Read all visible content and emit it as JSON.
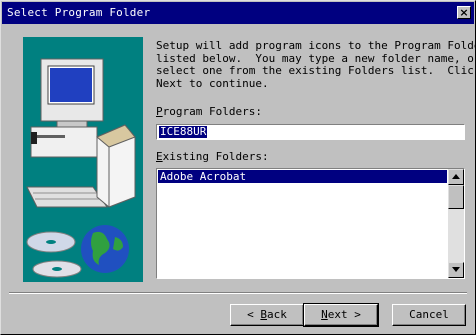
{
  "window": {
    "title": "Select Program Folder",
    "close_label": "×"
  },
  "intro_text": "Setup will add program icons to the Program Folder\nlisted below.  You may type a new folder name, or\nselect one from the existing Folders list.  Click\nNext to continue.",
  "program_folders": {
    "label_hotkey": "P",
    "label_rest": "rogram Folders:",
    "value": "ICE88UR"
  },
  "existing_folders": {
    "label_hotkey": "E",
    "label_rest": "xisting Folders:",
    "items": [
      {
        "label": "Adobe Acrobat",
        "selected": true
      }
    ]
  },
  "buttons": {
    "back_prefix": "< ",
    "back_hotkey": "B",
    "back_rest": "ack",
    "next_hotkey": "N",
    "next_rest": "ext >",
    "cancel_label": "Cancel"
  },
  "colors": {
    "titlebar": "#000080",
    "art_background": "#008080",
    "selection": "#000080"
  }
}
